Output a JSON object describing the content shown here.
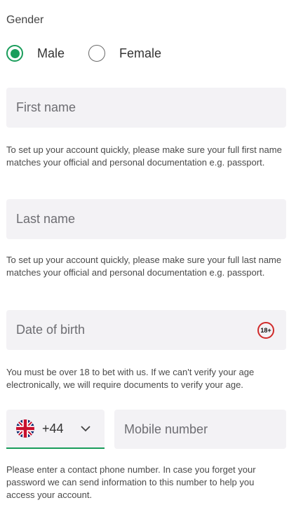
{
  "gender": {
    "label": "Gender",
    "options": [
      {
        "label": "Male",
        "selected": true
      },
      {
        "label": "Female",
        "selected": false
      }
    ]
  },
  "first_name": {
    "placeholder": "First name",
    "help": "To set up your account quickly, please make sure your full first name matches your official and personal documentation e.g. passport."
  },
  "last_name": {
    "placeholder": "Last name",
    "help": "To set up your account quickly, please make sure your full last name matches your official and personal documentation e.g. passport."
  },
  "dob": {
    "placeholder": "Date of birth",
    "badge": "18+",
    "help": "You must be over 18 to bet with us. If we can't verify your age electronically, we will require documents to verify your age."
  },
  "phone": {
    "country_flag": "uk-flag-icon",
    "country_code": "+44",
    "placeholder": "Mobile number",
    "help": "Please enter a contact phone number. In case you forget your password we can send information to this number to help you access your account."
  },
  "colors": {
    "accent": "#1a9d5b",
    "field_bg": "#f3f2f5",
    "badge_ring": "#d02a2a"
  }
}
